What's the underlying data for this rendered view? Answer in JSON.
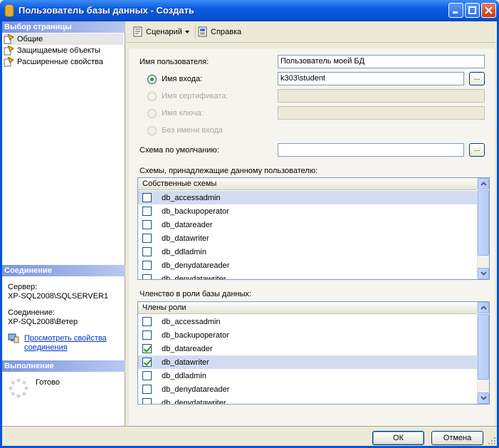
{
  "window": {
    "title": "Пользователь базы данных - Создать"
  },
  "left": {
    "select_page_header": "Выбор страницы",
    "pages": [
      {
        "label": "Общие",
        "selected": true
      },
      {
        "label": "Защищаемые объекты"
      },
      {
        "label": "Расширенные свойства"
      }
    ],
    "connection_header": "Соединение",
    "server_label": "Сервер:",
    "server_value": "XP-SQL2008\\SQLSERVER1",
    "connection_label": "Соединение:",
    "connection_value": "XP-SQL2008\\Ветер",
    "view_props_line1": "Просмотреть свойства",
    "view_props_line2": "соединения",
    "progress_header": "Выполнение",
    "progress_status": "Готово"
  },
  "toolbar": {
    "script_label": "Сценарий",
    "help_label": "Справка"
  },
  "form": {
    "username_label": "Имя пользователя:",
    "username_value": "Пользователь моей БД",
    "login_label": "Имя входа:",
    "login_value": "k303\\student",
    "cert_label": "Имя сертификата:",
    "key_label": "Имя ключа:",
    "no_login_label": "Без имени входа",
    "browse_label": "...",
    "default_schema_label": "Схема по умолчанию:",
    "owned_schemas_label": "Схемы, принадлежащие данному пользователю:",
    "owned_schemas_header": "Собственные схемы",
    "owned_schemas": [
      {
        "name": "db_accessadmin",
        "checked": false
      },
      {
        "name": "db_backupoperator",
        "checked": false
      },
      {
        "name": "db_datareader",
        "checked": false
      },
      {
        "name": "db_datawriter",
        "checked": false
      },
      {
        "name": "db_ddladmin",
        "checked": false
      },
      {
        "name": "db_denydatareader",
        "checked": false
      },
      {
        "name": "db_denydatawriter",
        "checked": false
      }
    ],
    "role_membership_label": "Членство в роли базы данных:",
    "role_members_header": "Члены роли",
    "role_members": [
      {
        "name": "db_accessadmin",
        "checked": false
      },
      {
        "name": "db_backupoperator",
        "checked": false
      },
      {
        "name": "db_datareader",
        "checked": true
      },
      {
        "name": "db_datawriter",
        "checked": true
      },
      {
        "name": "db_ddladmin",
        "checked": false
      },
      {
        "name": "db_denydatareader",
        "checked": false
      },
      {
        "name": "db_denydatawriter",
        "checked": false
      }
    ]
  },
  "buttons": {
    "ok": "ОК",
    "cancel": "Отмена"
  },
  "colors": {
    "titlebar": "#0a5ce0",
    "section_header": "#7a96df",
    "selection": "#d2dcf0",
    "check": "#21a121"
  }
}
